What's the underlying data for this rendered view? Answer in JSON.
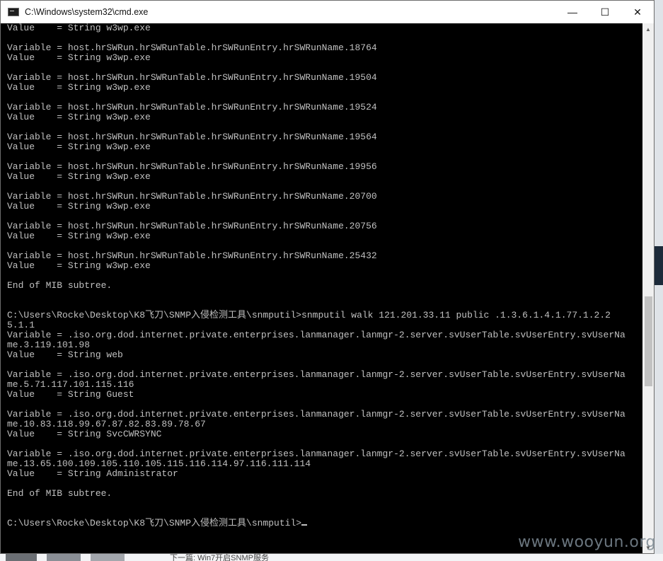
{
  "window": {
    "title": "C:\\Windows\\system32\\cmd.exe",
    "minimize_glyph": "—",
    "maximize_glyph": "☐",
    "close_glyph": "✕"
  },
  "console": {
    "text": "Value    = String w3wp.exe\n\nVariable = host.hrSWRun.hrSWRunTable.hrSWRunEntry.hrSWRunName.18764\nValue    = String w3wp.exe\n\nVariable = host.hrSWRun.hrSWRunTable.hrSWRunEntry.hrSWRunName.19504\nValue    = String w3wp.exe\n\nVariable = host.hrSWRun.hrSWRunTable.hrSWRunEntry.hrSWRunName.19524\nValue    = String w3wp.exe\n\nVariable = host.hrSWRun.hrSWRunTable.hrSWRunEntry.hrSWRunName.19564\nValue    = String w3wp.exe\n\nVariable = host.hrSWRun.hrSWRunTable.hrSWRunEntry.hrSWRunName.19956\nValue    = String w3wp.exe\n\nVariable = host.hrSWRun.hrSWRunTable.hrSWRunEntry.hrSWRunName.20700\nValue    = String w3wp.exe\n\nVariable = host.hrSWRun.hrSWRunTable.hrSWRunEntry.hrSWRunName.20756\nValue    = String w3wp.exe\n\nVariable = host.hrSWRun.hrSWRunTable.hrSWRunEntry.hrSWRunName.25432\nValue    = String w3wp.exe\n\nEnd of MIB subtree.\n\n\nC:\\Users\\Rocke\\Desktop\\K8飞刀\\SNMP入侵检测工具\\snmputil>snmputil walk 121.201.33.11 public .1.3.6.1.4.1.77.1.2.2\n5.1.1\nVariable = .iso.org.dod.internet.private.enterprises.lanmanager.lanmgr-2.server.svUserTable.svUserEntry.svUserNa\nme.3.119.101.98\nValue    = String web\n\nVariable = .iso.org.dod.internet.private.enterprises.lanmanager.lanmgr-2.server.svUserTable.svUserEntry.svUserNa\nme.5.71.117.101.115.116\nValue    = String Guest\n\nVariable = .iso.org.dod.internet.private.enterprises.lanmanager.lanmgr-2.server.svUserTable.svUserEntry.svUserNa\nme.10.83.118.99.67.87.82.83.89.78.67\nValue    = String SvcCWRSYNC\n\nVariable = .iso.org.dod.internet.private.enterprises.lanmanager.lanmgr-2.server.svUserTable.svUserEntry.svUserNa\nme.13.65.100.109.105.110.105.115.116.114.97.116.111.114\nValue    = String Administrator\n\nEnd of MIB subtree.\n\n\nC:\\Users\\Rocke\\Desktop\\K8飞刀\\SNMP入侵检测工具\\snmputil>"
  },
  "scrollbar": {
    "up_glyph": "▲",
    "down_glyph": "▼"
  },
  "watermark": "www.wooyun.org",
  "background": {
    "bottom_caption": "下一篇: Win7开启SNMP服务"
  }
}
